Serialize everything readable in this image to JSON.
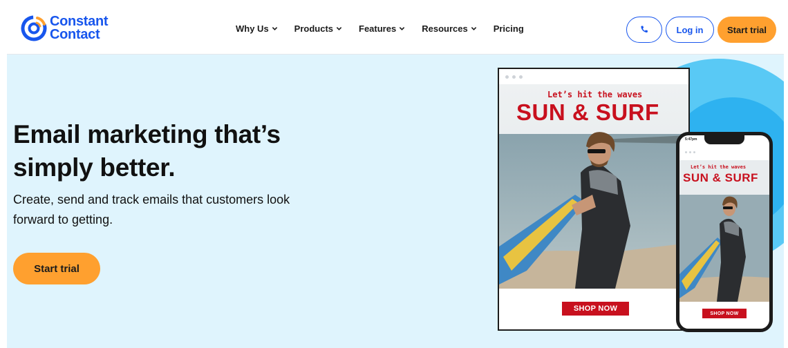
{
  "brand": {
    "name_line1": "Constant",
    "name_line2": "Contact",
    "logo_color": "#1856ed"
  },
  "nav": {
    "items": [
      {
        "label": "Why Us",
        "has_dropdown": true
      },
      {
        "label": "Products",
        "has_dropdown": true
      },
      {
        "label": "Features",
        "has_dropdown": true
      },
      {
        "label": "Resources",
        "has_dropdown": true
      },
      {
        "label": "Pricing",
        "has_dropdown": false
      }
    ],
    "phone_icon": "phone-icon",
    "login_label": "Log in",
    "start_trial_label": "Start trial"
  },
  "hero": {
    "title": "Email marketing that’s simply better.",
    "subtitle": "Create, send and track emails that customers look forward to getting.",
    "cta_label": "Start trial",
    "accent_color": "#ffa02f",
    "background_color": "#dff4fd"
  },
  "email_preview": {
    "kicker": "Let’s hit the waves",
    "headline": "SUN & SURF",
    "button_label": "SHOP NOW",
    "accent_color": "#c8101e"
  },
  "phone_preview": {
    "time": "5:47pm",
    "kicker": "Let’s hit the waves",
    "headline": "SUN & SURF",
    "button_label": "SHOP NOW"
  }
}
